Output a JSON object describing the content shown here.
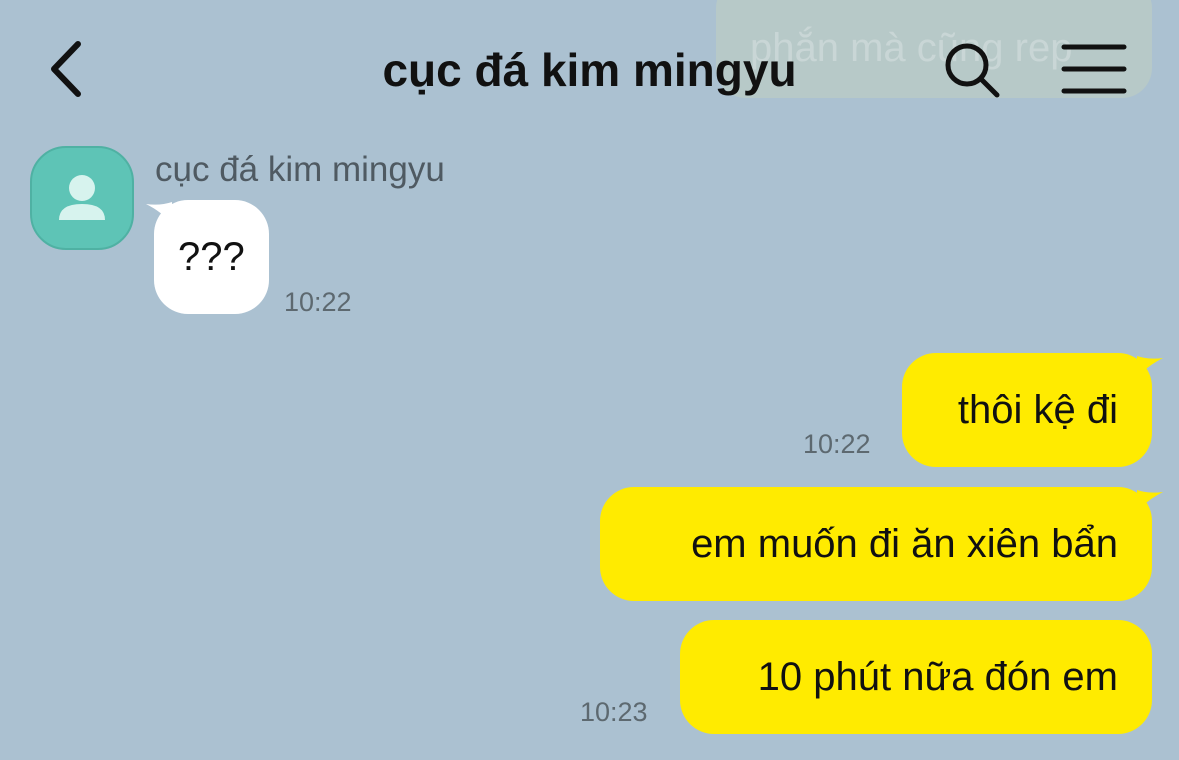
{
  "header": {
    "title": "cục đá kim mingyu",
    "back_icon": "chevron-left-icon",
    "search_icon": "search-icon",
    "menu_icon": "hamburger-menu-icon"
  },
  "ghost_preview": {
    "text": "phắn mà cũng rep"
  },
  "contact": {
    "name": "cục đá kim mingyu",
    "avatar_icon": "person-icon",
    "avatar_color": "#5ec4b6"
  },
  "messages": [
    {
      "direction": "incoming",
      "text": "???",
      "time": "10:22"
    },
    {
      "direction": "outgoing",
      "text": "thôi kệ đi",
      "time": "10:22"
    },
    {
      "direction": "outgoing",
      "text": "em muốn đi ăn xiên bẩn",
      "time": ""
    },
    {
      "direction": "outgoing",
      "text": "10 phút nữa đón em",
      "time": "10:23"
    }
  ],
  "colors": {
    "background": "#abc1d1",
    "outgoing_bubble": "#ffeb00",
    "incoming_bubble": "#ffffff"
  }
}
